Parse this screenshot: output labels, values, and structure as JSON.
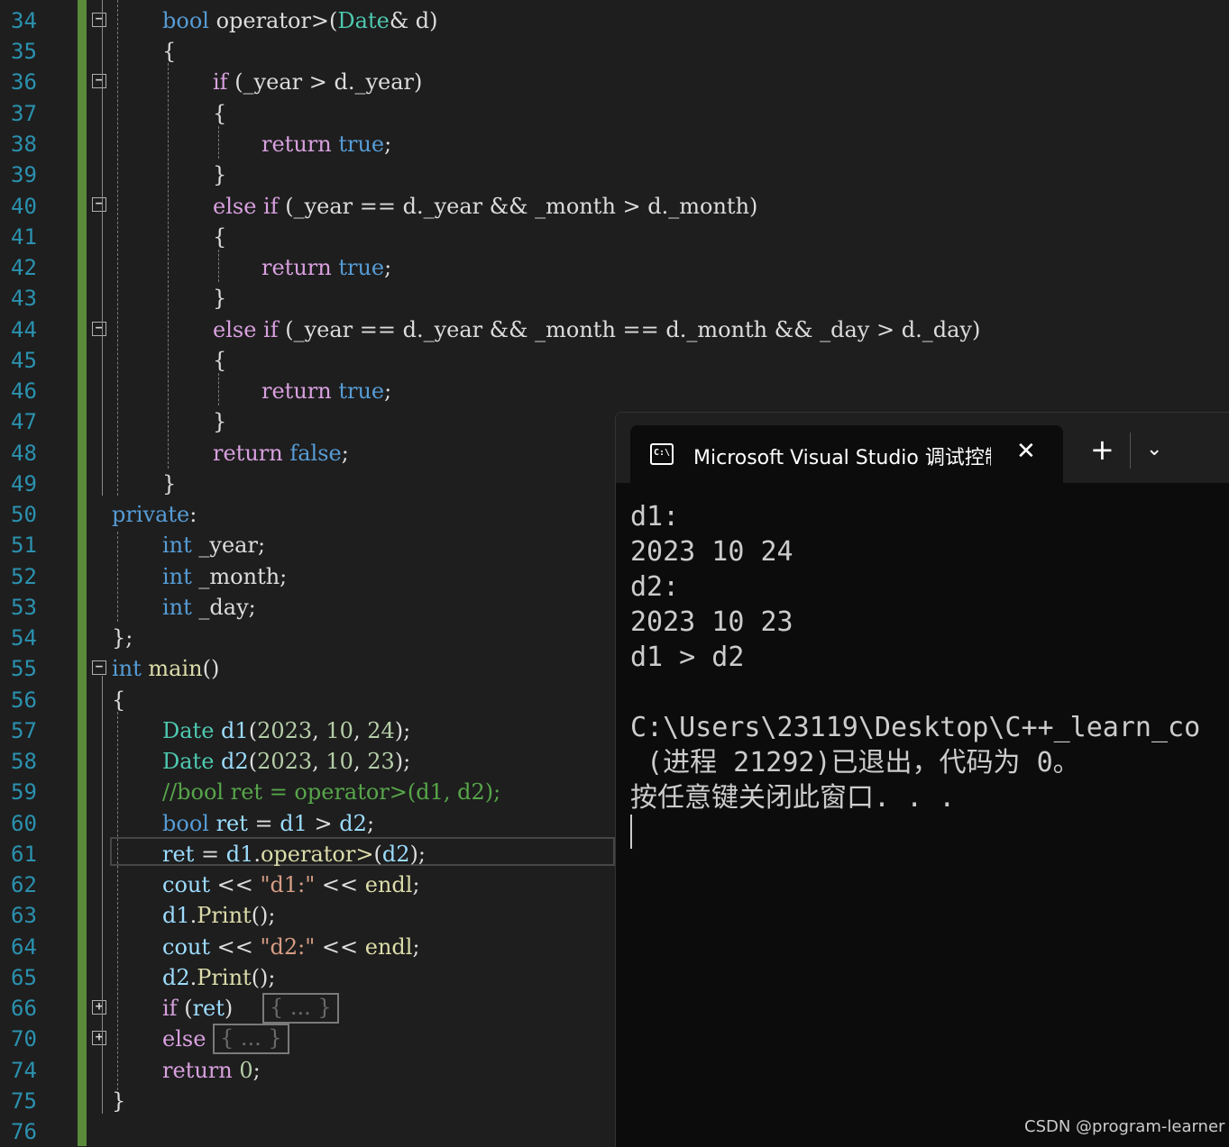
{
  "line_numbers": [
    "34",
    "35",
    "36",
    "37",
    "38",
    "39",
    "40",
    "41",
    "42",
    "43",
    "44",
    "45",
    "46",
    "47",
    "48",
    "49",
    "50",
    "51",
    "52",
    "53",
    "54",
    "55",
    "56",
    "57",
    "58",
    "59",
    "60",
    "61",
    "62",
    "63",
    "64",
    "65",
    "66",
    "70",
    "74",
    "75",
    "76"
  ],
  "terminal": {
    "tab_title": "Microsoft Visual Studio 调试控制台",
    "tab_icon_text": "C:\\",
    "close_glyph": "✕",
    "new_tab_glyph": "+",
    "dropdown_glyph": "⌄",
    "lines": [
      "d1:",
      "2023 10 24",
      "d2:",
      "2023 10 23",
      "d1 > d2",
      "",
      "C:\\Users\\23119\\Desktop\\C++_learn_co",
      " (进程 21292)已退出，代码为 0。",
      "按任意键关闭此窗口. . ."
    ]
  },
  "watermark": "CSDN @program-learner"
}
